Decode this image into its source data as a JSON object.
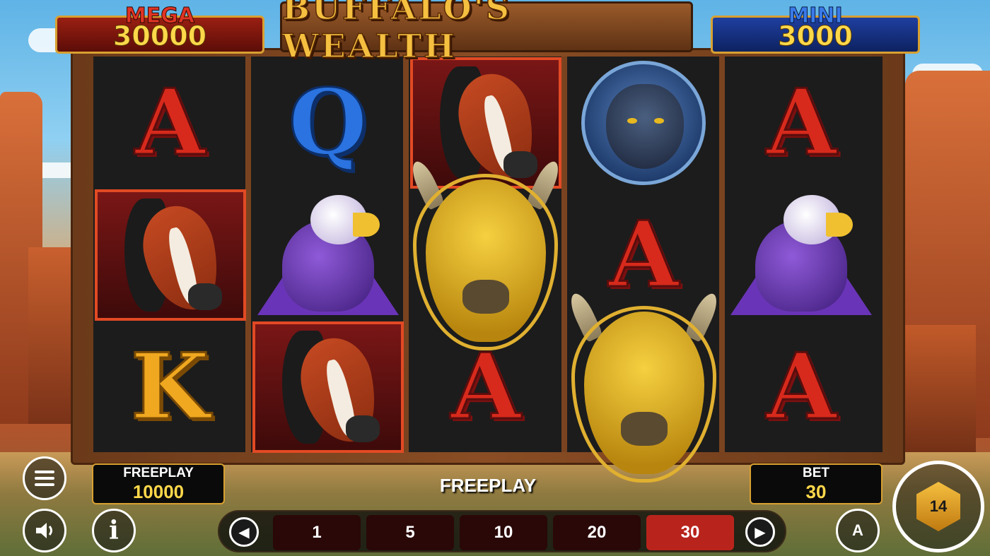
{
  "game": {
    "title": "BUFFALO'S WEALTH"
  },
  "jackpots": {
    "mega": {
      "label": "MEGA",
      "value": "30000"
    },
    "mini": {
      "label": "MINI",
      "value": "3000"
    }
  },
  "reels": [
    [
      "A",
      "horse",
      "K"
    ],
    [
      "Q",
      "eagle",
      "horse"
    ],
    [
      "horse",
      "buffalo",
      "A"
    ],
    [
      "panther",
      "A",
      "buffalo"
    ],
    [
      "A",
      "eagle",
      "A"
    ]
  ],
  "balance": {
    "label": "FREEPLAY",
    "value": "10000"
  },
  "mode_label": "FREEPLAY",
  "bet": {
    "label": "BET",
    "value": "30"
  },
  "bet_options": [
    "1",
    "5",
    "10",
    "20",
    "30"
  ],
  "selected_bet": "30",
  "controls": {
    "auto_label": "A",
    "spin_badge": "14"
  },
  "colors": {
    "accent_gold": "#ffd84a",
    "mega_red": "#9a1f12",
    "mini_blue": "#1f3fa0",
    "selected_bet": "#b8241c"
  },
  "icons": [
    "menu-icon",
    "speaker-icon",
    "info-icon",
    "prev-arrow-icon",
    "next-arrow-icon",
    "autoplay-icon",
    "spin-icon"
  ]
}
